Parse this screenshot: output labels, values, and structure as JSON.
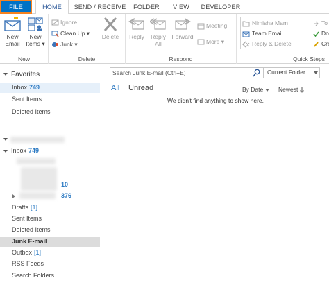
{
  "tabs": {
    "file": "FILE",
    "home": "HOME",
    "send_receive": "SEND / RECEIVE",
    "folder": "FOLDER",
    "view": "VIEW",
    "developer": "DEVELOPER"
  },
  "ribbon": {
    "new_group": {
      "label": "New",
      "new_email": [
        "New",
        "Email"
      ],
      "new_items": [
        "New",
        "Items"
      ]
    },
    "delete_group": {
      "label": "Delete",
      "ignore": "Ignore",
      "clean_up": "Clean Up",
      "junk": "Junk",
      "delete": "Delete"
    },
    "respond_group": {
      "label": "Respond",
      "reply": "Reply",
      "reply_all": [
        "Reply",
        "All"
      ],
      "forward": "Forward",
      "meeting": "Meeting",
      "more": "More"
    },
    "quick_steps_group": {
      "label": "Quick Steps",
      "steps": [
        "Nimisha Mam",
        "Team Email",
        "Reply & Delete"
      ],
      "steps_col2": [
        "To M",
        "Done",
        "Crea"
      ]
    }
  },
  "nav": {
    "favorites_header": "Favorites",
    "favorites": [
      {
        "label": "Inbox",
        "count": "749"
      },
      {
        "label": "Sent Items"
      },
      {
        "label": "Deleted Items"
      }
    ],
    "account": {
      "inbox": {
        "label": "Inbox",
        "count": "749"
      },
      "sub_counts": [
        "10",
        "376"
      ],
      "drafts": {
        "label": "Drafts",
        "count": "[1]"
      },
      "sent": "Sent Items",
      "deleted": "Deleted Items",
      "junk": "Junk E-mail",
      "outbox": {
        "label": "Outbox",
        "count": "[1]"
      },
      "rss": "RSS Feeds",
      "search_folders": "Search Folders"
    }
  },
  "main": {
    "search_placeholder": "Search Junk E-mail (Ctrl+E)",
    "scope": "Current Folder",
    "filter_all": "All",
    "filter_unread": "Unread",
    "sort_by": "By Date",
    "sort_order": "Newest",
    "empty_message": "We didn't find anything to show here."
  },
  "colors": {
    "accent": "#0072c6",
    "file_border": "#f5821f",
    "count_blue": "#2b79c2"
  }
}
